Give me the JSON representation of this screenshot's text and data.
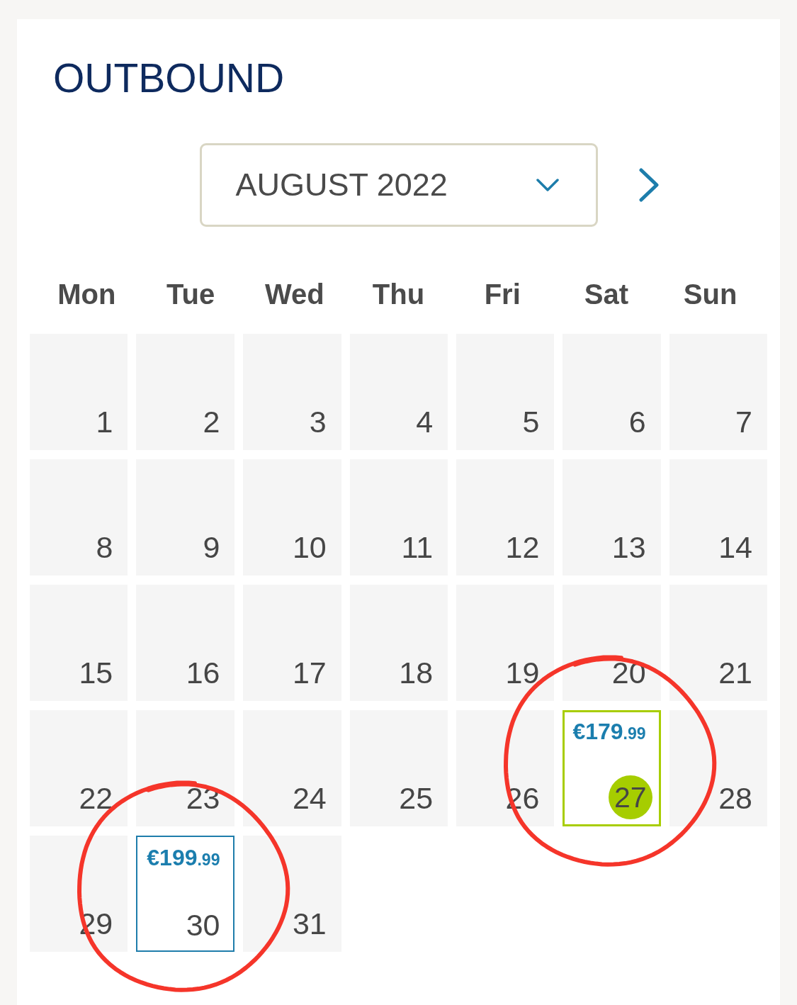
{
  "title": "OUTBOUND",
  "month_picker": {
    "value": "AUGUST 2022"
  },
  "weekdays": [
    "Mon",
    "Tue",
    "Wed",
    "Thu",
    "Fri",
    "Sat",
    "Sun"
  ],
  "weeks": [
    {
      "days": [
        {
          "number": "1",
          "selected": false,
          "circled": false
        },
        {
          "number": "2",
          "selected": false,
          "circled": false
        },
        {
          "number": "3",
          "selected": false,
          "circled": false
        },
        {
          "number": "4",
          "selected": false,
          "circled": false
        },
        {
          "number": "5",
          "selected": false,
          "circled": false
        },
        {
          "number": "6",
          "selected": false,
          "circled": false
        },
        {
          "number": "7",
          "selected": false,
          "circled": false
        }
      ]
    },
    {
      "days": [
        {
          "number": "8",
          "selected": false,
          "circled": false
        },
        {
          "number": "9",
          "selected": false,
          "circled": false
        },
        {
          "number": "10",
          "selected": false,
          "circled": false
        },
        {
          "number": "11",
          "selected": false,
          "circled": false
        },
        {
          "number": "12",
          "selected": false,
          "circled": false
        },
        {
          "number": "13",
          "selected": false,
          "circled": false
        },
        {
          "number": "14",
          "selected": false,
          "circled": false
        }
      ]
    },
    {
      "days": [
        {
          "number": "15",
          "selected": false,
          "circled": false
        },
        {
          "number": "16",
          "selected": false,
          "circled": false
        },
        {
          "number": "17",
          "selected": false,
          "circled": false
        },
        {
          "number": "18",
          "selected": false,
          "circled": false
        },
        {
          "number": "19",
          "selected": false,
          "circled": false
        },
        {
          "number": "20",
          "selected": false,
          "circled": false
        },
        {
          "number": "21",
          "selected": false,
          "circled": false
        }
      ]
    },
    {
      "days": [
        {
          "number": "22",
          "selected": false,
          "circled": false
        },
        {
          "number": "23",
          "selected": false,
          "circled": false
        },
        {
          "number": "24",
          "selected": false,
          "circled": false
        },
        {
          "number": "25",
          "selected": false,
          "circled": false
        },
        {
          "number": "26",
          "selected": false,
          "circled": false
        },
        {
          "number": "27",
          "selected": true,
          "circled": true,
          "price": {
            "whole": "€179",
            "fraction": ".99"
          }
        },
        {
          "number": "28",
          "selected": false,
          "circled": false
        }
      ]
    },
    {
      "days": [
        {
          "number": "29",
          "selected": false,
          "circled": false
        },
        {
          "number": "30",
          "selected": false,
          "circled": true,
          "price": {
            "whole": "€199",
            "fraction": ".99"
          }
        },
        {
          "number": "31",
          "selected": false,
          "circled": false
        }
      ]
    }
  ]
}
